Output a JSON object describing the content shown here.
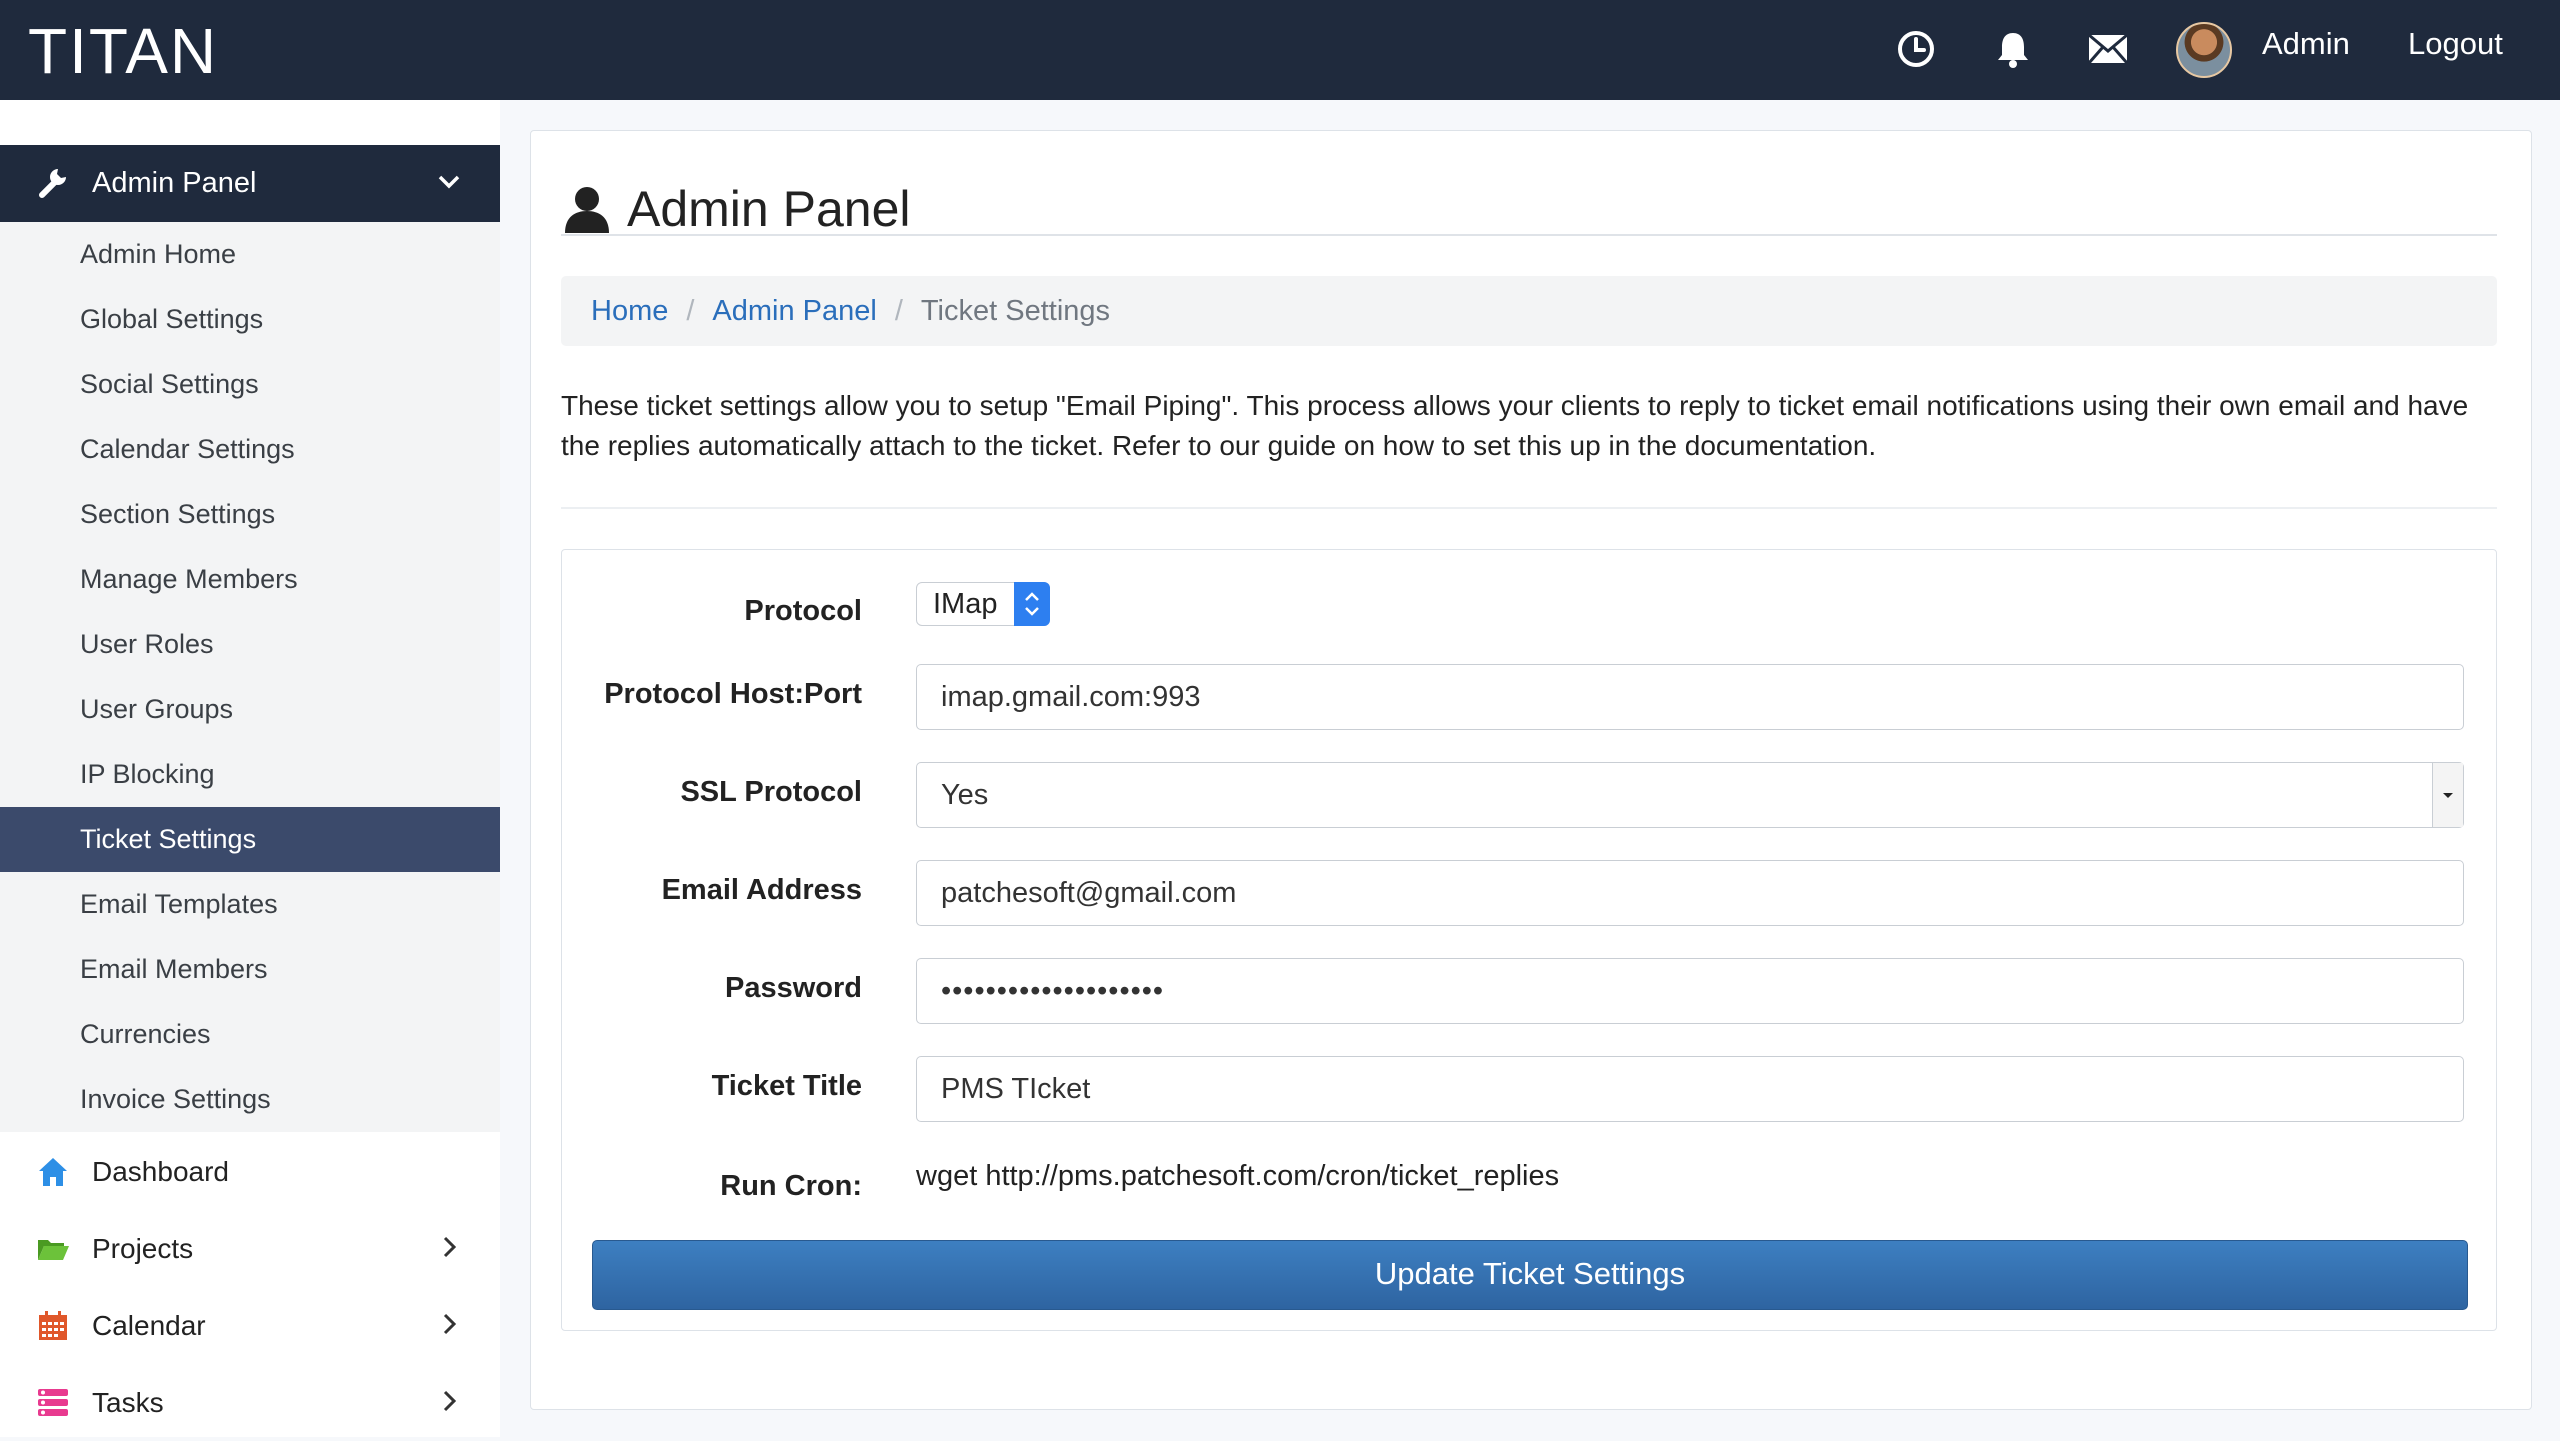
{
  "app": {
    "brand": "TITAN"
  },
  "topbar": {
    "icons": [
      "clock-icon",
      "bell-icon",
      "envelope-icon"
    ],
    "user_label": "Admin",
    "logout_label": "Logout"
  },
  "sidebar": {
    "section": {
      "label": "Admin Panel",
      "icon": "wrench-icon"
    },
    "items": [
      {
        "label": "Admin Home"
      },
      {
        "label": "Global Settings"
      },
      {
        "label": "Social Settings"
      },
      {
        "label": "Calendar Settings"
      },
      {
        "label": "Section Settings"
      },
      {
        "label": "Manage Members"
      },
      {
        "label": "User Roles"
      },
      {
        "label": "User Groups"
      },
      {
        "label": "IP Blocking"
      },
      {
        "label": "Ticket Settings",
        "active": true
      },
      {
        "label": "Email Templates"
      },
      {
        "label": "Email Members"
      },
      {
        "label": "Currencies"
      },
      {
        "label": "Invoice Settings"
      }
    ],
    "nav": [
      {
        "label": "Dashboard",
        "icon": "home-icon",
        "color": "#2d8fe6"
      },
      {
        "label": "Projects",
        "icon": "folder-icon",
        "color": "#59b52d"
      },
      {
        "label": "Calendar",
        "icon": "calendar-icon",
        "color": "#e0572a"
      },
      {
        "label": "Tasks",
        "icon": "tasks-icon",
        "color": "#e83a8f"
      }
    ]
  },
  "main": {
    "title": "Admin Panel",
    "breadcrumb": [
      "Home",
      "Admin Panel",
      "Ticket Settings"
    ],
    "description": "These ticket settings allow you to setup \"Email Piping\". This process allows your clients to reply to ticket email notifications using their own email and have the replies automatically attach to the ticket. Refer to our guide on how to set this up in the documentation.",
    "form": {
      "protocol_label": "Protocol",
      "protocol_value": "IMap",
      "host_label": "Protocol Host:Port",
      "host_value": "imap.gmail.com:993",
      "ssl_label": "SSL Protocol",
      "ssl_value": "Yes",
      "email_label": "Email Address",
      "email_value": "patchesoft@gmail.com",
      "password_label": "Password",
      "password_value": "••••••••••••••••••••",
      "title_label": "Ticket Title",
      "title_value": "PMS TIcket",
      "cron_label": "Run Cron:",
      "cron_value": "wget http://pms.patchesoft.com/cron/ticket_replies",
      "submit_label": "Update Ticket Settings"
    }
  },
  "colors": {
    "topbar": "#1f2a3d",
    "active": "#3b4a6b",
    "link": "#2a6ebb",
    "button": "#3d7fc1"
  }
}
